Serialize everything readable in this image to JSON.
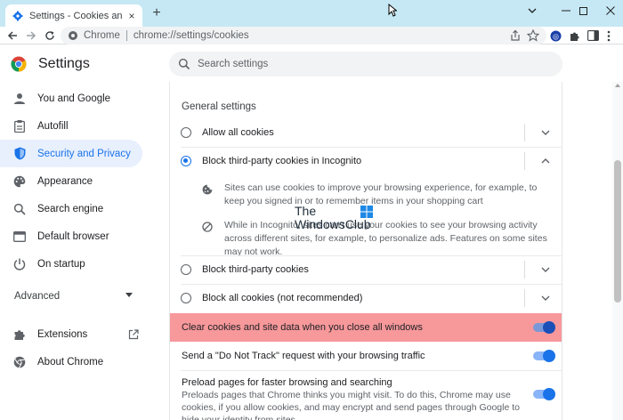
{
  "window": {
    "tab_title": "Settings - Cookies and other site",
    "new_tab_symbol": "+",
    "close_symbol": "×"
  },
  "toolbar": {
    "scheme_label": "Chrome",
    "url": "chrome://settings/cookies"
  },
  "header": {
    "title": "Settings",
    "search_placeholder": "Search settings"
  },
  "sidebar": {
    "items": [
      {
        "label": "You and Google",
        "icon": "person-icon"
      },
      {
        "label": "Autofill",
        "icon": "clipboard-icon"
      },
      {
        "label": "Security and Privacy",
        "icon": "shield-icon",
        "active": true
      },
      {
        "label": "Appearance",
        "icon": "palette-icon"
      },
      {
        "label": "Search engine",
        "icon": "search-icon"
      },
      {
        "label": "Default browser",
        "icon": "browser-icon"
      },
      {
        "label": "On startup",
        "icon": "power-icon"
      }
    ],
    "advanced_label": "Advanced",
    "extensions_label": "Extensions",
    "about_label": "About Chrome"
  },
  "main": {
    "section_title": "General settings",
    "options": [
      {
        "label": "Allow all cookies",
        "checked": false,
        "expanded": false
      },
      {
        "label": "Block third-party cookies in Incognito",
        "checked": true,
        "expanded": true
      },
      {
        "label": "Block third-party cookies",
        "checked": false,
        "expanded": false
      },
      {
        "label": "Block all cookies (not recommended)",
        "checked": false,
        "expanded": false
      }
    ],
    "details": [
      "Sites can use cookies to improve your browsing experience, for example, to keep you signed in or to remember items in your shopping cart",
      "While in Incognito, sites can't use your cookies to see your browsing activity across different sites, for example, to personalize ads. Features on some sites may not work."
    ],
    "clear_on_exit_label": "Clear cookies and site data when you close all windows",
    "do_not_track_label": "Send a \"Do Not Track\" request with your browsing traffic",
    "preload_title": "Preload pages for faster browsing and searching",
    "preload_desc": "Preloads pages that Chrome thinks you might visit. To do this, Chrome may use cookies, if you allow cookies, and may encrypt and send pages through Google to hide your identity from sites.",
    "toggles": {
      "clear_on_exit": true,
      "do_not_track": true,
      "preload": true
    }
  },
  "watermark": {
    "line1": "The",
    "line2": "WindowsClub"
  },
  "colors": {
    "accent": "#1a73e8",
    "highlight": "#f7989b",
    "titlebar": "#c6e8f4"
  }
}
